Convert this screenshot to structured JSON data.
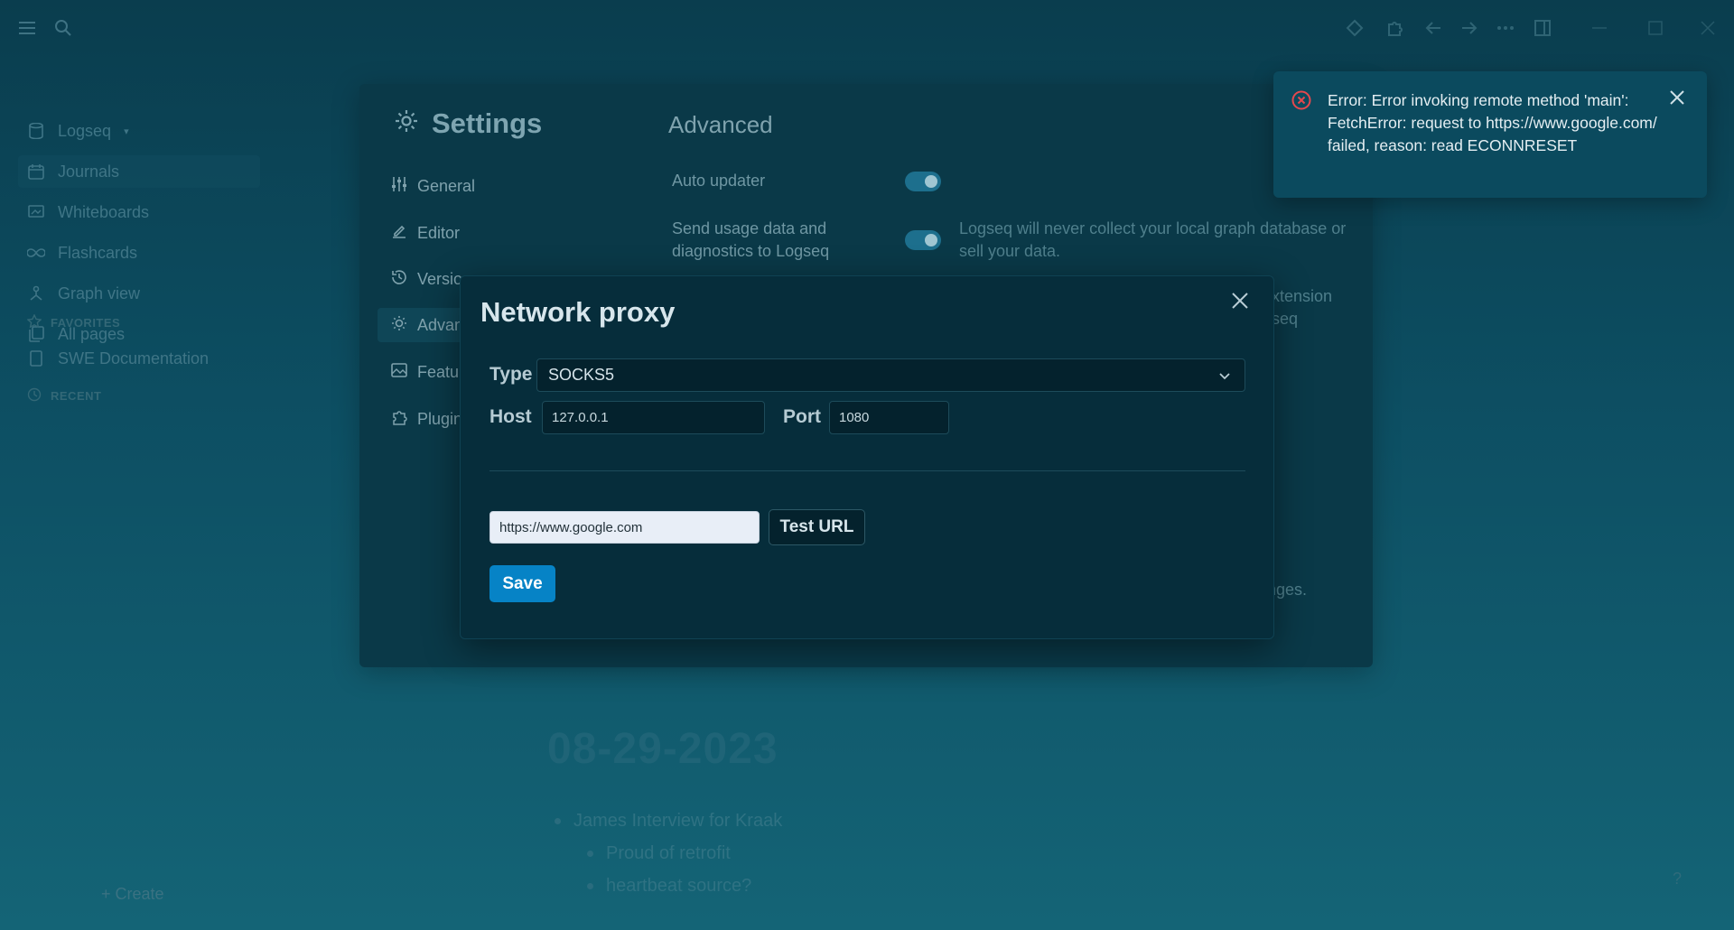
{
  "sidebar": {
    "graph_name": "Logseq",
    "items": [
      {
        "label": "Journals",
        "icon": "calendar-icon"
      },
      {
        "label": "Whiteboards",
        "icon": "whiteboard-icon"
      },
      {
        "label": "Flashcards",
        "icon": "infinity-icon"
      },
      {
        "label": "Graph view",
        "icon": "graph-icon"
      },
      {
        "label": "All pages",
        "icon": "pages-icon"
      }
    ],
    "favorites_label": "FAVORITES",
    "favorite_page": "SWE Documentation",
    "recent_label": "RECENT",
    "create_label": "+ Create"
  },
  "settings": {
    "title": "Settings",
    "nav": [
      {
        "label": "General",
        "icon": "sliders-icon"
      },
      {
        "label": "Editor",
        "icon": "editor-icon"
      },
      {
        "label": "Versio",
        "icon": "history-icon"
      },
      {
        "label": "Advan",
        "icon": "bulb-icon"
      },
      {
        "label": "Featu",
        "icon": "image-icon"
      },
      {
        "label": "Plugin",
        "icon": "puzzle-icon"
      }
    ],
    "section_title": "Advanced",
    "auto_updater_label": "Auto updater",
    "usage_data_label": "Send usage data and diagnostics to Logseq",
    "usage_data_desc": "Logseq will never collect your local graph database or sell your data.",
    "partial_desc_1": "xtension",
    "partial_desc_2": "seq",
    "partial_desc_3": "nges."
  },
  "dialog": {
    "title": "Network proxy",
    "type_label": "Type",
    "type_value": "SOCKS5",
    "host_label": "Host",
    "host_value": "127.0.0.1",
    "port_label": "Port",
    "port_value": "1080",
    "test_url_value": "https://www.google.com",
    "test_button": "Test URL",
    "save_button": "Save"
  },
  "toast": {
    "message": "Error: Error invoking remote method 'main': FetchError: request to https://www.google.com/ failed, reason: read ECONNRESET"
  },
  "journal": {
    "date": "08-29-2023",
    "bullets": [
      "James Interview for Kraak",
      "Proud of retrofit",
      "heartbeat source?"
    ]
  },
  "colors": {
    "accent": "#0683c6",
    "error": "#e5484d",
    "toast_bg": "#0b4a5e",
    "dialog_bg": "#062d3b"
  }
}
